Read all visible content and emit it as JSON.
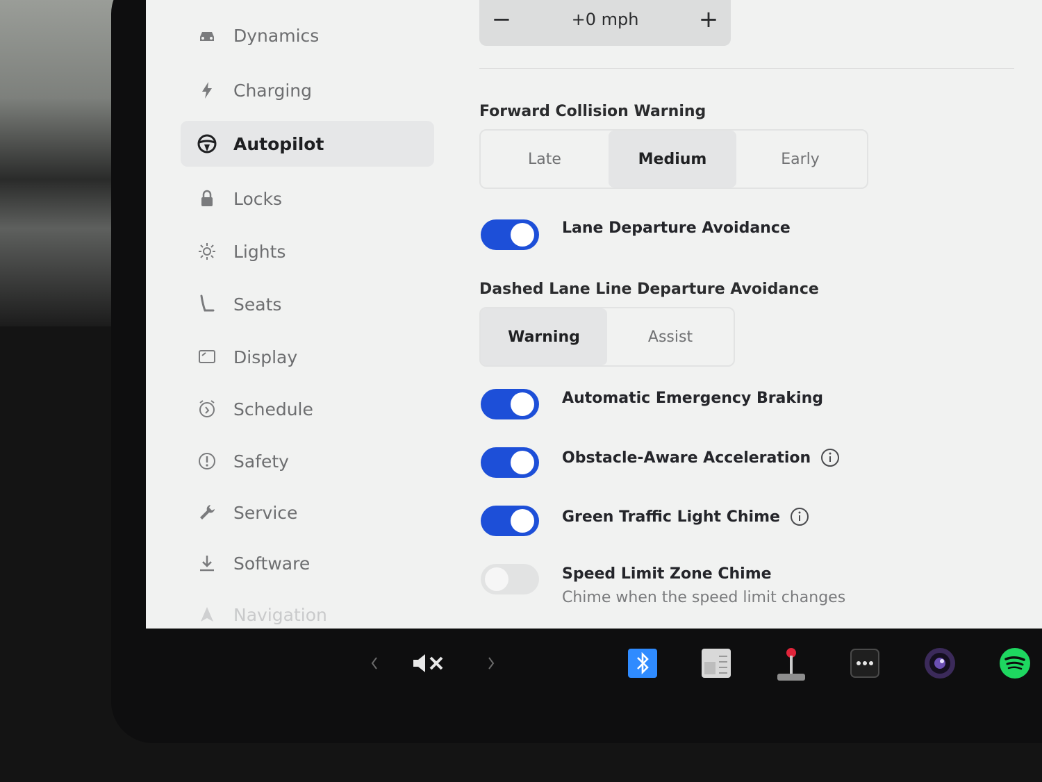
{
  "sidebar": {
    "items": [
      {
        "label": "Dynamics",
        "icon": "car-icon"
      },
      {
        "label": "Charging",
        "icon": "lightning-icon"
      },
      {
        "label": "Autopilot",
        "icon": "steering-wheel-icon",
        "active": true
      },
      {
        "label": "Locks",
        "icon": "lock-icon"
      },
      {
        "label": "Lights",
        "icon": "sun-icon"
      },
      {
        "label": "Seats",
        "icon": "seat-icon"
      },
      {
        "label": "Display",
        "icon": "display-icon"
      },
      {
        "label": "Schedule",
        "icon": "alarm-clock-icon"
      },
      {
        "label": "Safety",
        "icon": "alert-circle-icon"
      },
      {
        "label": "Service",
        "icon": "wrench-icon"
      },
      {
        "label": "Software",
        "icon": "download-icon"
      },
      {
        "label": "Navigation",
        "icon": "navigation-arrow-icon"
      }
    ]
  },
  "speed_offset": {
    "minus": "−",
    "value": "+0 mph",
    "plus": "+"
  },
  "forward_collision": {
    "label": "Forward Collision Warning",
    "options": [
      "Late",
      "Medium",
      "Early"
    ],
    "selected": "Medium"
  },
  "lane_departure": {
    "label": "Lane Departure Avoidance",
    "on": true
  },
  "dashed_lane": {
    "label": "Dashed Lane Line Departure Avoidance",
    "options": [
      "Warning",
      "Assist"
    ],
    "selected": "Warning"
  },
  "toggles": {
    "aeb": {
      "label": "Automatic Emergency Braking",
      "on": true
    },
    "obstacle": {
      "label": "Obstacle-Aware Acceleration",
      "on": true
    },
    "green_light": {
      "label": "Green Traffic Light Chime",
      "on": true
    },
    "speed_zone": {
      "label": "Speed Limit Zone Chime",
      "sub": "Chime when the speed limit changes",
      "on": false
    }
  },
  "taskbar": {
    "icons": [
      "chevron-left-icon",
      "volume-mute-icon",
      "chevron-right-icon",
      "bluetooth-icon",
      "calendar-icon",
      "joystick-icon",
      "more-dots-icon",
      "camera-icon",
      "spotify-icon"
    ]
  },
  "colors": {
    "accent": "#1d4fd8",
    "spotify": "#1ed760",
    "bluetooth": "#2f8bff"
  }
}
